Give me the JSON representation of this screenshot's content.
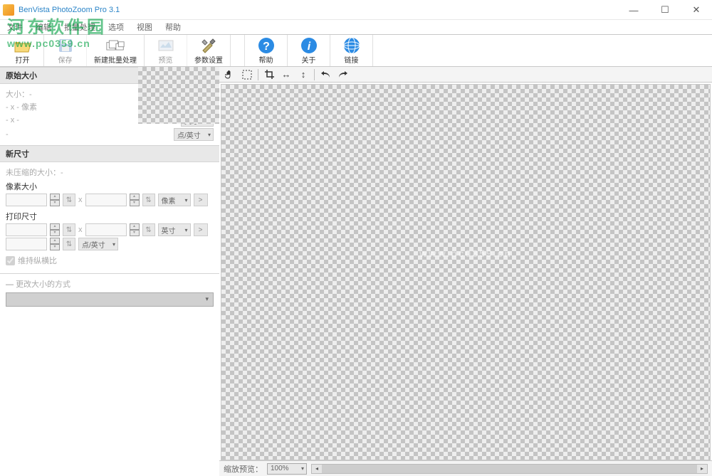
{
  "title": "BenVista PhotoZoom Pro 3.1",
  "menubar": [
    "文件",
    "编辑",
    "批量处理",
    "选项",
    "视图",
    "帮助"
  ],
  "watermark": {
    "cn": "河东软件园",
    "en": "www.pc0359.cn"
  },
  "toolbar": {
    "open": "打开",
    "save": "保存",
    "batch": "新建批量处理",
    "preview": "预览",
    "settings": "参数设置",
    "help": "帮助",
    "about": "关于",
    "links": "链接"
  },
  "panel": {
    "origSize": "原始大小",
    "origSizeLabel": "大小：-",
    "origPixels": "- x - 像素",
    "origDash": "- x -",
    "unitInch": "英寸",
    "unitDpi": "点/英寸",
    "newSize": "新尺寸",
    "uncompressed": "未压缩的大小：-",
    "pixelSize": "像素大小",
    "unitPixel": "像素",
    "printSize": "打印尺寸",
    "keepAspect": "维持纵横比",
    "resizeMethod": "更改大小的方式"
  },
  "canvasTools": {
    "hand": "hand-icon",
    "marquee": "marquee-icon",
    "crop": "crop-icon",
    "flipH": "flip-horizontal-icon",
    "flipV": "flip-vertical-icon",
    "undo": "undo-icon",
    "redo": "redo-icon"
  },
  "canvasWatermark": "www.pc0359.cn",
  "status": {
    "zoomLabel": "缩放预览：",
    "zoomValue": "100%"
  }
}
